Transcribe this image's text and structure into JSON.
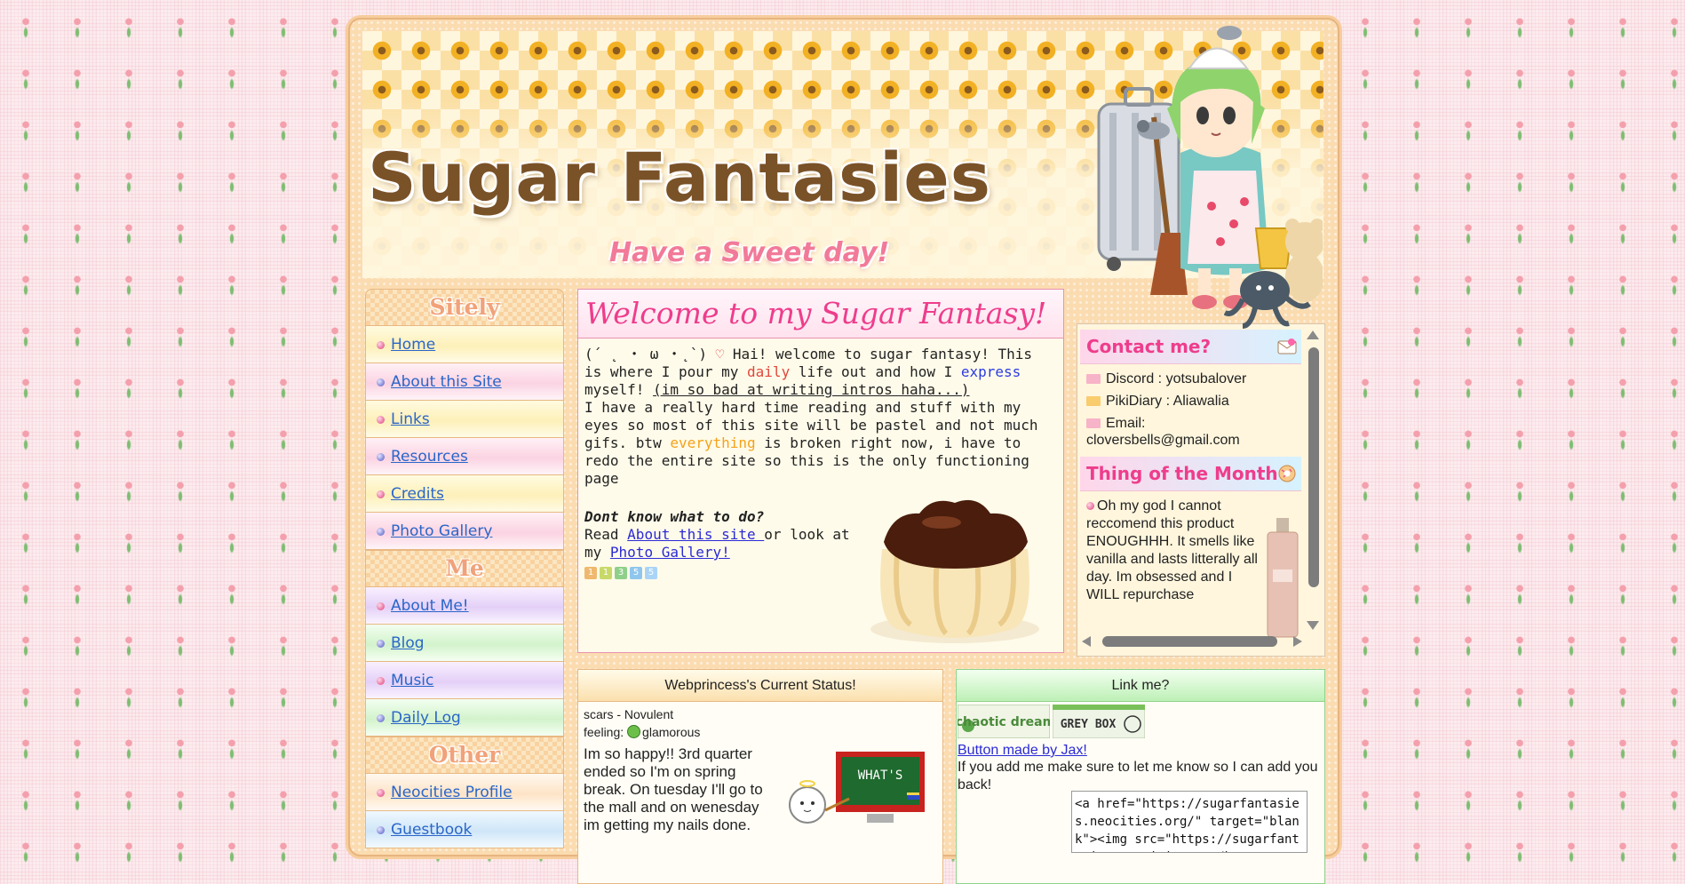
{
  "site": {
    "title": "Sugar Fantasies",
    "subtitle": "Have a Sweet day!"
  },
  "nav": {
    "sections": [
      {
        "heading": "Sitely"
      },
      {
        "heading": "Me"
      },
      {
        "heading": "Other"
      }
    ],
    "sitely": [
      "Home",
      "About this Site",
      "Links",
      "Resources",
      "Credits",
      "Photo Gallery"
    ],
    "me": [
      "About Me!",
      "Blog",
      "Music",
      "Daily Log"
    ],
    "other": [
      "Neocities Profile",
      "Guestbook"
    ]
  },
  "welcome": {
    "heading": "Welcome to my Sugar Fantasy!",
    "intro_face": "(´ ˛ ・ ω ・˛`)",
    "heart": "♡",
    "intro_1": " Hai! welcome to sugar fantasy! This is where I pour my ",
    "word_daily": "daily",
    "intro_2": " life out and how I ",
    "word_express": "express",
    "intro_3": " myself! ",
    "intro_aside": "(im so bad at writing intros haha...)",
    "para2_a": "I have a really hard time reading and stuff with my eyes so most of this site will be pastel and not much gifs. btw ",
    "word_everything": "everything",
    "para2_b": " is broken right now, i have to redo the entire site so this is the only functioning page",
    "question": "Dont know what to do?",
    "read": "Read ",
    "about_link": "About this site ",
    "or_look": "or look at my ",
    "gallery_link": "Photo Gallery!",
    "hit_counter": [
      "1",
      "1",
      "3",
      "5",
      "5"
    ]
  },
  "contact": {
    "heading": "Contact me?",
    "discord": "Discord : yotsubalover",
    "pikidiary": "PikiDiary : Aliawalia",
    "email_label": "Email:",
    "email": "cloversbells@gmail.com"
  },
  "thing_of_month": {
    "heading": "Thing of the Month",
    "text": "Oh my god I cannot reccomend this product ENOUGHHH. It smells like vanilla and lasts litterally all day. Im obsessed and I WILL repurchase"
  },
  "status": {
    "heading": "Webprincess's Current Status!",
    "song": "scars - Novulent",
    "feeling_label": "feeling:",
    "feeling": "glamorous",
    "text": "Im so happy!! 3rd quarter ended so I'm on spring break. On tuesday I'll go to the mall and on wenesday im getting my nails done.",
    "board_label": "WHAT'S"
  },
  "linkme": {
    "heading": "Link me?",
    "btn1_text": "chaotic dreamz",
    "btn2_text": "GREY BOX",
    "credit_link": "Button made by Jax!",
    "instructions": "If you add me make sure to let me know so I can add you back!",
    "code": "<a href=\"https://sugarfantasies.neocities.org/\" target=\"blank\"><img src=\"https://sugarfantasies.neocities.org/button.png\"></a>"
  },
  "colors": {
    "accent_pink": "#ee3d8c",
    "link_blue": "#2a66c9",
    "title_brown": "#7a5228",
    "frame_peach": "#fbdcb1"
  },
  "icons": [
    "bullet-icon",
    "envelope-icon",
    "mail-badge-icon",
    "donut-badge-icon",
    "mood-icon",
    "scroll-arrow-icon"
  ]
}
